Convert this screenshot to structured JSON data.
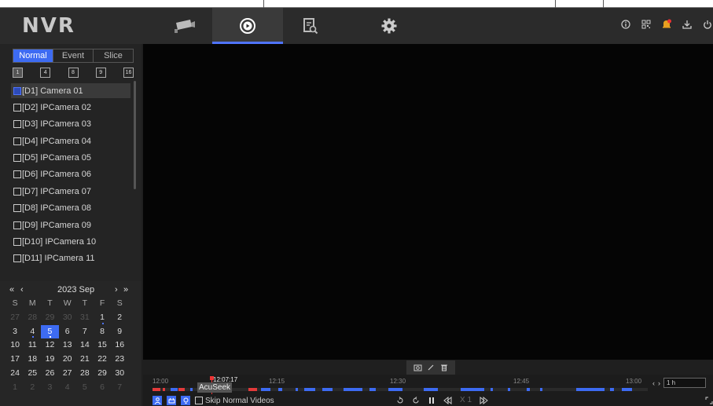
{
  "app": {
    "logo": "NVR"
  },
  "nav": {
    "tabs": [
      {
        "name": "live-view",
        "icon": "camera-icon"
      },
      {
        "name": "playback",
        "icon": "playback-icon",
        "active": true
      },
      {
        "name": "search",
        "icon": "file-search-icon"
      },
      {
        "name": "settings",
        "icon": "gear-icon"
      }
    ],
    "right_icons": [
      "info-icon",
      "qr-code-icon",
      "alarm-bell-icon",
      "download-icon",
      "power-icon"
    ]
  },
  "sidebar": {
    "mode_tabs": [
      "Normal",
      "Event",
      "Slice"
    ],
    "active_mode": "Normal",
    "splits": [
      "1",
      "4",
      "8",
      "9",
      "16"
    ],
    "cameras": [
      {
        "label": "[D1] Camera 01",
        "checked": true
      },
      {
        "label": "[D2] IPCamera 02"
      },
      {
        "label": "[D3] IPCamera 03"
      },
      {
        "label": "[D4] IPCamera 04"
      },
      {
        "label": "[D5] IPCamera 05"
      },
      {
        "label": "[D6] IPCamera 06"
      },
      {
        "label": "[D7] IPCamera 07"
      },
      {
        "label": "[D8] IPCamera 08"
      },
      {
        "label": "[D9] IPCamera 09"
      },
      {
        "label": "[D10] IPCamera 10"
      },
      {
        "label": "[D11] IPCamera 11"
      }
    ]
  },
  "calendar": {
    "month_label": "2023 Sep",
    "prev_year": "«",
    "prev_month": "‹",
    "next_month": "›",
    "next_year": "»",
    "weekdays": [
      "S",
      "M",
      "T",
      "W",
      "T",
      "F",
      "S"
    ],
    "selected": "5",
    "days": [
      [
        "27",
        "28",
        "29",
        "30",
        "31",
        "1",
        "2"
      ],
      [
        "3",
        "4",
        "5",
        "6",
        "7",
        "8",
        "9"
      ],
      [
        "10",
        "11",
        "12",
        "13",
        "14",
        "15",
        "16"
      ],
      [
        "17",
        "18",
        "19",
        "20",
        "21",
        "22",
        "23"
      ],
      [
        "24",
        "25",
        "26",
        "27",
        "28",
        "29",
        "30"
      ],
      [
        "1",
        "2",
        "3",
        "4",
        "5",
        "6",
        "7"
      ]
    ]
  },
  "timeline": {
    "labels": [
      "12:00",
      "12:15",
      "12:30",
      "12:45",
      "13:00"
    ],
    "cursor_time": "12:07:17",
    "tooltip": "AcuSeek",
    "skip_label": "Skip Normal Videos",
    "speed": "X 1",
    "zoom_value": "1 h",
    "colors": {
      "normal": "#3d6bf2",
      "event": "#e33a3a"
    }
  }
}
